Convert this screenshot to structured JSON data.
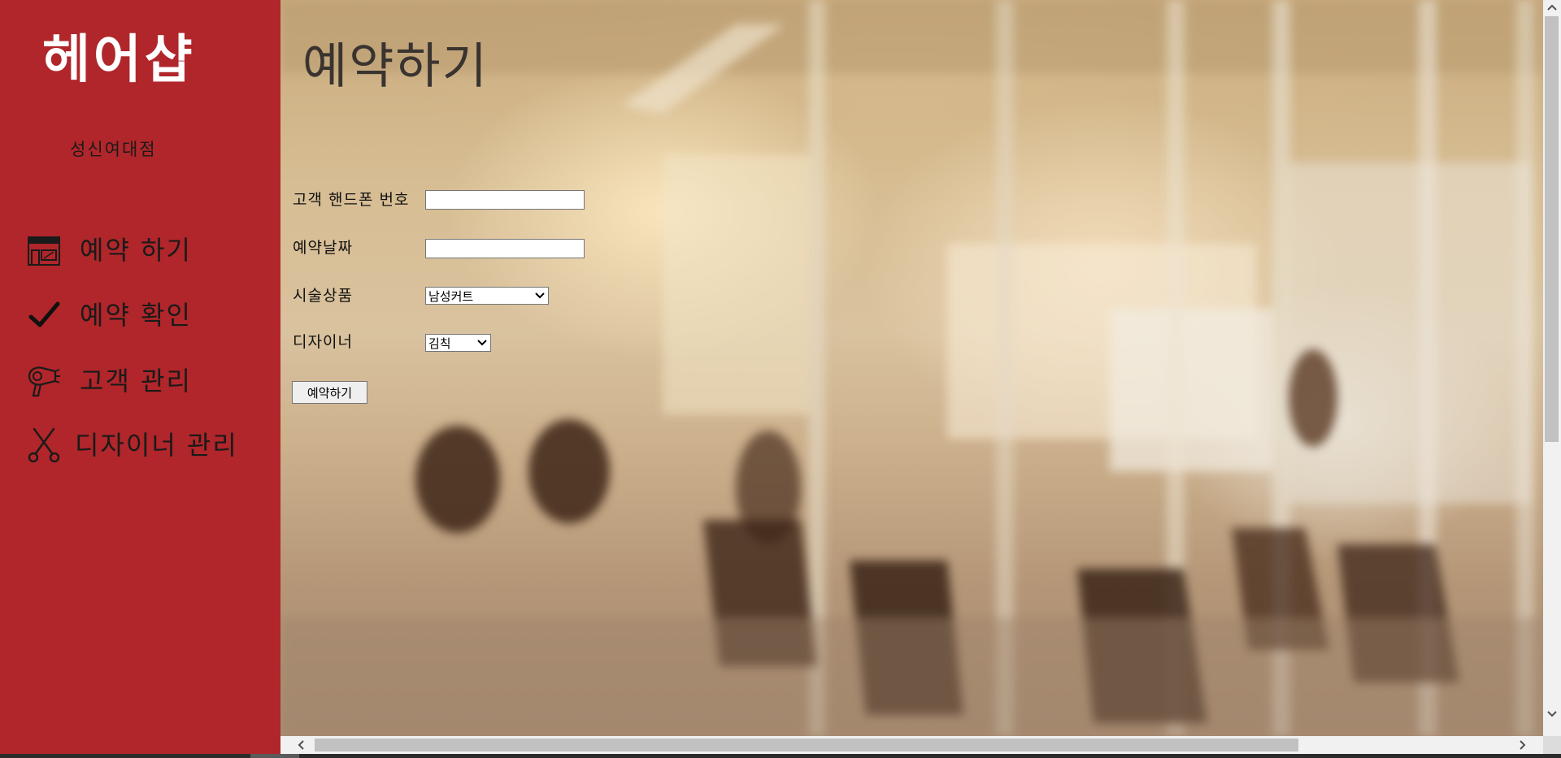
{
  "sidebar": {
    "brand_title": "헤어샵",
    "branch_name": "성신여대점",
    "background_color": "#b0262a",
    "items": [
      {
        "label": "예약 하기",
        "icon": "storefront-icon"
      },
      {
        "label": "예약 확인",
        "icon": "checkmark-icon"
      },
      {
        "label": "고객 관리",
        "icon": "hair-dryer-icon"
      },
      {
        "label": "디자이너 관리",
        "icon": "scissors-icon"
      }
    ]
  },
  "main": {
    "page_title": "예약하기",
    "background": "blurred-hair-salon-interior-photo",
    "form": {
      "phone_label": "고객 핸드폰 번호",
      "phone_value": "",
      "date_label": "예약날짜",
      "date_value": "",
      "service_label": "시술상품",
      "service_selected": "남성커트",
      "designer_label": "디자이너",
      "designer_selected": "김칙",
      "submit_label": "예약하기"
    }
  },
  "scrollbars": {
    "vertical": {
      "up_icon": "chevron-up-icon",
      "down_icon": "chevron-down-icon"
    },
    "horizontal": {
      "left_icon": "chevron-left-icon",
      "right_icon": "chevron-right-icon"
    }
  }
}
